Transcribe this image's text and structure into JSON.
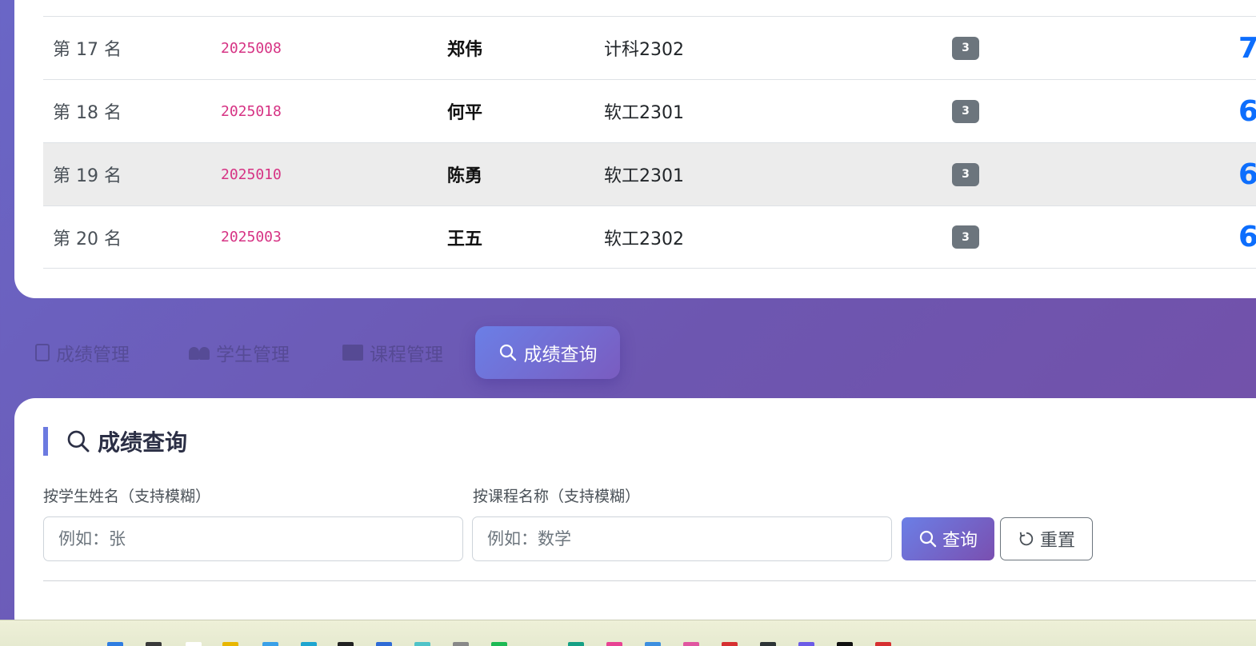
{
  "ranking": {
    "rows": [
      {
        "rank": "第 17 名",
        "student_id": "2025008",
        "name": "郑伟",
        "class": "计科2302",
        "courses": "3",
        "score": "7",
        "highlight": false
      },
      {
        "rank": "第 18 名",
        "student_id": "2025018",
        "name": "何平",
        "class": "软工2301",
        "courses": "3",
        "score": "6",
        "highlight": false
      },
      {
        "rank": "第 19 名",
        "student_id": "2025010",
        "name": "陈勇",
        "class": "软工2301",
        "courses": "3",
        "score": "6",
        "highlight": true
      },
      {
        "rank": "第 20 名",
        "student_id": "2025003",
        "name": "王五",
        "class": "软工2302",
        "courses": "3",
        "score": "6",
        "highlight": false
      }
    ]
  },
  "tabs": [
    {
      "label": "成绩管理",
      "icon": "clipboard-icon",
      "active": false
    },
    {
      "label": "学生管理",
      "icon": "people-icon",
      "active": false
    },
    {
      "label": "课程管理",
      "icon": "book-icon",
      "active": false
    },
    {
      "label": "成绩查询",
      "icon": "search-icon",
      "active": true
    }
  ],
  "search": {
    "title": "成绩查询",
    "student_label": "按学生姓名（支持模糊）",
    "student_placeholder": "例如：张",
    "course_label": "按课程名称（支持模糊）",
    "course_placeholder": "例如：数学",
    "query_button": "查询",
    "reset_button": "重置"
  },
  "colors": {
    "accent": "#6b7fe6",
    "score": "#0d6efd",
    "student_id": "#d63384",
    "badge": "#6c757d"
  }
}
